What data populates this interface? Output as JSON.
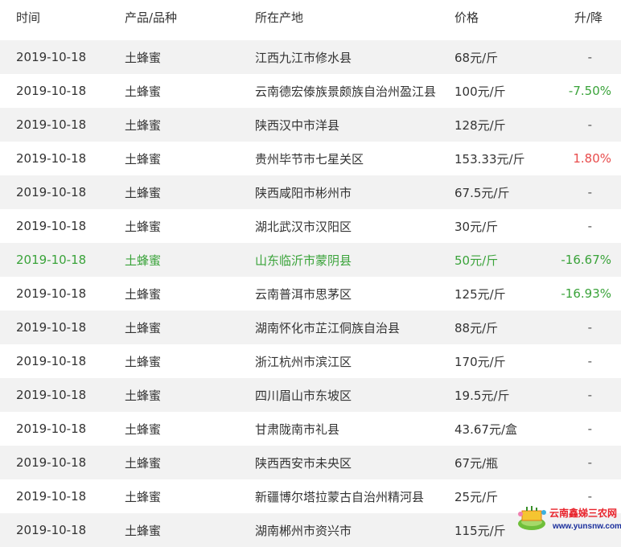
{
  "table": {
    "headers": [
      "时间",
      "产品/品种",
      "所在产地",
      "价格",
      "升/降"
    ],
    "rows": [
      {
        "date": "2019-10-18",
        "product": "土蜂蜜",
        "origin": "江西九江市修水县",
        "price": "68元/斤",
        "change": "-",
        "trend": "flat"
      },
      {
        "date": "2019-10-18",
        "product": "土蜂蜜",
        "origin": "云南德宏傣族景颇族自治州盈江县",
        "price": "100元/斤",
        "change": "-7.50%",
        "trend": "down"
      },
      {
        "date": "2019-10-18",
        "product": "土蜂蜜",
        "origin": "陕西汉中市洋县",
        "price": "128元/斤",
        "change": "-",
        "trend": "flat"
      },
      {
        "date": "2019-10-18",
        "product": "土蜂蜜",
        "origin": "贵州毕节市七星关区",
        "price": "153.33元/斤",
        "change": "1.80%",
        "trend": "up"
      },
      {
        "date": "2019-10-18",
        "product": "土蜂蜜",
        "origin": "陕西咸阳市彬州市",
        "price": "67.5元/斤",
        "change": "-",
        "trend": "flat"
      },
      {
        "date": "2019-10-18",
        "product": "土蜂蜜",
        "origin": "湖北武汉市汉阳区",
        "price": "30元/斤",
        "change": "-",
        "trend": "flat"
      },
      {
        "date": "2019-10-18",
        "product": "土蜂蜜",
        "origin": "山东临沂市蒙阴县",
        "price": "50元/斤",
        "change": "-16.67%",
        "trend": "down",
        "highlight": true
      },
      {
        "date": "2019-10-18",
        "product": "土蜂蜜",
        "origin": "云南普洱市思茅区",
        "price": "125元/斤",
        "change": "-16.93%",
        "trend": "down"
      },
      {
        "date": "2019-10-18",
        "product": "土蜂蜜",
        "origin": "湖南怀化市芷江侗族自治县",
        "price": "88元/斤",
        "change": "-",
        "trend": "flat"
      },
      {
        "date": "2019-10-18",
        "product": "土蜂蜜",
        "origin": "浙江杭州市滨江区",
        "price": "170元/斤",
        "change": "-",
        "trend": "flat"
      },
      {
        "date": "2019-10-18",
        "product": "土蜂蜜",
        "origin": "四川眉山市东坡区",
        "price": "19.5元/斤",
        "change": "-",
        "trend": "flat"
      },
      {
        "date": "2019-10-18",
        "product": "土蜂蜜",
        "origin": "甘肃陇南市礼县",
        "price": "43.67元/盒",
        "change": "-",
        "trend": "flat"
      },
      {
        "date": "2019-10-18",
        "product": "土蜂蜜",
        "origin": "陕西西安市未央区",
        "price": "67元/瓶",
        "change": "-",
        "trend": "flat"
      },
      {
        "date": "2019-10-18",
        "product": "土蜂蜜",
        "origin": "新疆博尔塔拉蒙古自治州精河县",
        "price": "25元/斤",
        "change": "-",
        "trend": "flat"
      },
      {
        "date": "2019-10-18",
        "product": "土蜂蜜",
        "origin": "湖南郴州市资兴市",
        "price": "115元/斤",
        "change": "",
        "trend": "down"
      }
    ]
  },
  "watermark": {
    "title": "云南鑫娣三农网",
    "url": "www.yunsnw.com",
    "logo_icon": "leaf-globe-logo-icon",
    "title_color": "#e8222a",
    "url_color": "#1a2f9c"
  },
  "colors": {
    "up": "#e84b4b",
    "down": "#3aa33a",
    "highlight_row": "#3aa33a",
    "stripe": "#f2f2f2"
  }
}
